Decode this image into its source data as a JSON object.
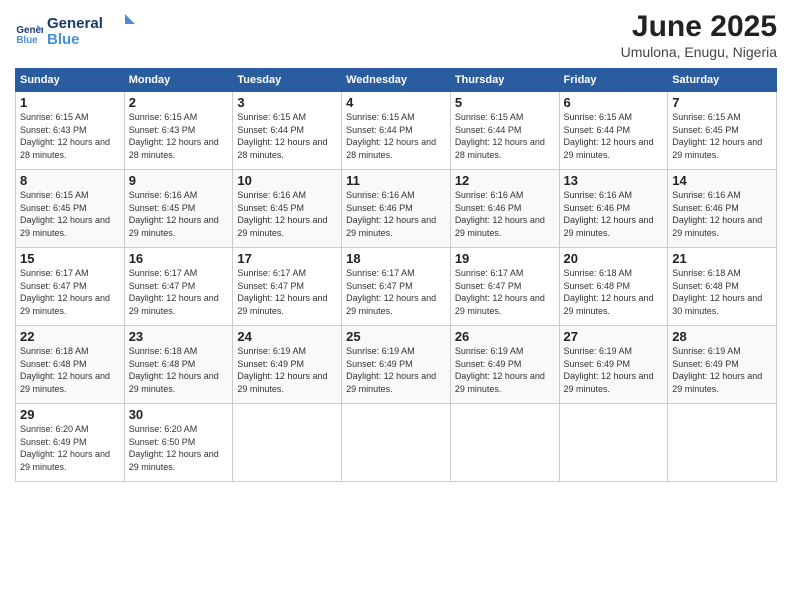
{
  "logo": {
    "line1": "General",
    "line2": "Blue"
  },
  "title": "June 2025",
  "subtitle": "Umulona, Enugu, Nigeria",
  "days_of_week": [
    "Sunday",
    "Monday",
    "Tuesday",
    "Wednesday",
    "Thursday",
    "Friday",
    "Saturday"
  ],
  "weeks": [
    [
      {
        "day": "1",
        "sunrise": "Sunrise: 6:15 AM",
        "sunset": "Sunset: 6:43 PM",
        "daylight": "Daylight: 12 hours and 28 minutes."
      },
      {
        "day": "2",
        "sunrise": "Sunrise: 6:15 AM",
        "sunset": "Sunset: 6:43 PM",
        "daylight": "Daylight: 12 hours and 28 minutes."
      },
      {
        "day": "3",
        "sunrise": "Sunrise: 6:15 AM",
        "sunset": "Sunset: 6:44 PM",
        "daylight": "Daylight: 12 hours and 28 minutes."
      },
      {
        "day": "4",
        "sunrise": "Sunrise: 6:15 AM",
        "sunset": "Sunset: 6:44 PM",
        "daylight": "Daylight: 12 hours and 28 minutes."
      },
      {
        "day": "5",
        "sunrise": "Sunrise: 6:15 AM",
        "sunset": "Sunset: 6:44 PM",
        "daylight": "Daylight: 12 hours and 28 minutes."
      },
      {
        "day": "6",
        "sunrise": "Sunrise: 6:15 AM",
        "sunset": "Sunset: 6:44 PM",
        "daylight": "Daylight: 12 hours and 29 minutes."
      },
      {
        "day": "7",
        "sunrise": "Sunrise: 6:15 AM",
        "sunset": "Sunset: 6:45 PM",
        "daylight": "Daylight: 12 hours and 29 minutes."
      }
    ],
    [
      {
        "day": "8",
        "sunrise": "Sunrise: 6:15 AM",
        "sunset": "Sunset: 6:45 PM",
        "daylight": "Daylight: 12 hours and 29 minutes."
      },
      {
        "day": "9",
        "sunrise": "Sunrise: 6:16 AM",
        "sunset": "Sunset: 6:45 PM",
        "daylight": "Daylight: 12 hours and 29 minutes."
      },
      {
        "day": "10",
        "sunrise": "Sunrise: 6:16 AM",
        "sunset": "Sunset: 6:45 PM",
        "daylight": "Daylight: 12 hours and 29 minutes."
      },
      {
        "day": "11",
        "sunrise": "Sunrise: 6:16 AM",
        "sunset": "Sunset: 6:46 PM",
        "daylight": "Daylight: 12 hours and 29 minutes."
      },
      {
        "day": "12",
        "sunrise": "Sunrise: 6:16 AM",
        "sunset": "Sunset: 6:46 PM",
        "daylight": "Daylight: 12 hours and 29 minutes."
      },
      {
        "day": "13",
        "sunrise": "Sunrise: 6:16 AM",
        "sunset": "Sunset: 6:46 PM",
        "daylight": "Daylight: 12 hours and 29 minutes."
      },
      {
        "day": "14",
        "sunrise": "Sunrise: 6:16 AM",
        "sunset": "Sunset: 6:46 PM",
        "daylight": "Daylight: 12 hours and 29 minutes."
      }
    ],
    [
      {
        "day": "15",
        "sunrise": "Sunrise: 6:17 AM",
        "sunset": "Sunset: 6:47 PM",
        "daylight": "Daylight: 12 hours and 29 minutes."
      },
      {
        "day": "16",
        "sunrise": "Sunrise: 6:17 AM",
        "sunset": "Sunset: 6:47 PM",
        "daylight": "Daylight: 12 hours and 29 minutes."
      },
      {
        "day": "17",
        "sunrise": "Sunrise: 6:17 AM",
        "sunset": "Sunset: 6:47 PM",
        "daylight": "Daylight: 12 hours and 29 minutes."
      },
      {
        "day": "18",
        "sunrise": "Sunrise: 6:17 AM",
        "sunset": "Sunset: 6:47 PM",
        "daylight": "Daylight: 12 hours and 29 minutes."
      },
      {
        "day": "19",
        "sunrise": "Sunrise: 6:17 AM",
        "sunset": "Sunset: 6:47 PM",
        "daylight": "Daylight: 12 hours and 29 minutes."
      },
      {
        "day": "20",
        "sunrise": "Sunrise: 6:18 AM",
        "sunset": "Sunset: 6:48 PM",
        "daylight": "Daylight: 12 hours and 29 minutes."
      },
      {
        "day": "21",
        "sunrise": "Sunrise: 6:18 AM",
        "sunset": "Sunset: 6:48 PM",
        "daylight": "Daylight: 12 hours and 30 minutes."
      }
    ],
    [
      {
        "day": "22",
        "sunrise": "Sunrise: 6:18 AM",
        "sunset": "Sunset: 6:48 PM",
        "daylight": "Daylight: 12 hours and 29 minutes."
      },
      {
        "day": "23",
        "sunrise": "Sunrise: 6:18 AM",
        "sunset": "Sunset: 6:48 PM",
        "daylight": "Daylight: 12 hours and 29 minutes."
      },
      {
        "day": "24",
        "sunrise": "Sunrise: 6:19 AM",
        "sunset": "Sunset: 6:49 PM",
        "daylight": "Daylight: 12 hours and 29 minutes."
      },
      {
        "day": "25",
        "sunrise": "Sunrise: 6:19 AM",
        "sunset": "Sunset: 6:49 PM",
        "daylight": "Daylight: 12 hours and 29 minutes."
      },
      {
        "day": "26",
        "sunrise": "Sunrise: 6:19 AM",
        "sunset": "Sunset: 6:49 PM",
        "daylight": "Daylight: 12 hours and 29 minutes."
      },
      {
        "day": "27",
        "sunrise": "Sunrise: 6:19 AM",
        "sunset": "Sunset: 6:49 PM",
        "daylight": "Daylight: 12 hours and 29 minutes."
      },
      {
        "day": "28",
        "sunrise": "Sunrise: 6:19 AM",
        "sunset": "Sunset: 6:49 PM",
        "daylight": "Daylight: 12 hours and 29 minutes."
      }
    ],
    [
      {
        "day": "29",
        "sunrise": "Sunrise: 6:20 AM",
        "sunset": "Sunset: 6:49 PM",
        "daylight": "Daylight: 12 hours and 29 minutes."
      },
      {
        "day": "30",
        "sunrise": "Sunrise: 6:20 AM",
        "sunset": "Sunset: 6:50 PM",
        "daylight": "Daylight: 12 hours and 29 minutes."
      },
      null,
      null,
      null,
      null,
      null
    ]
  ]
}
